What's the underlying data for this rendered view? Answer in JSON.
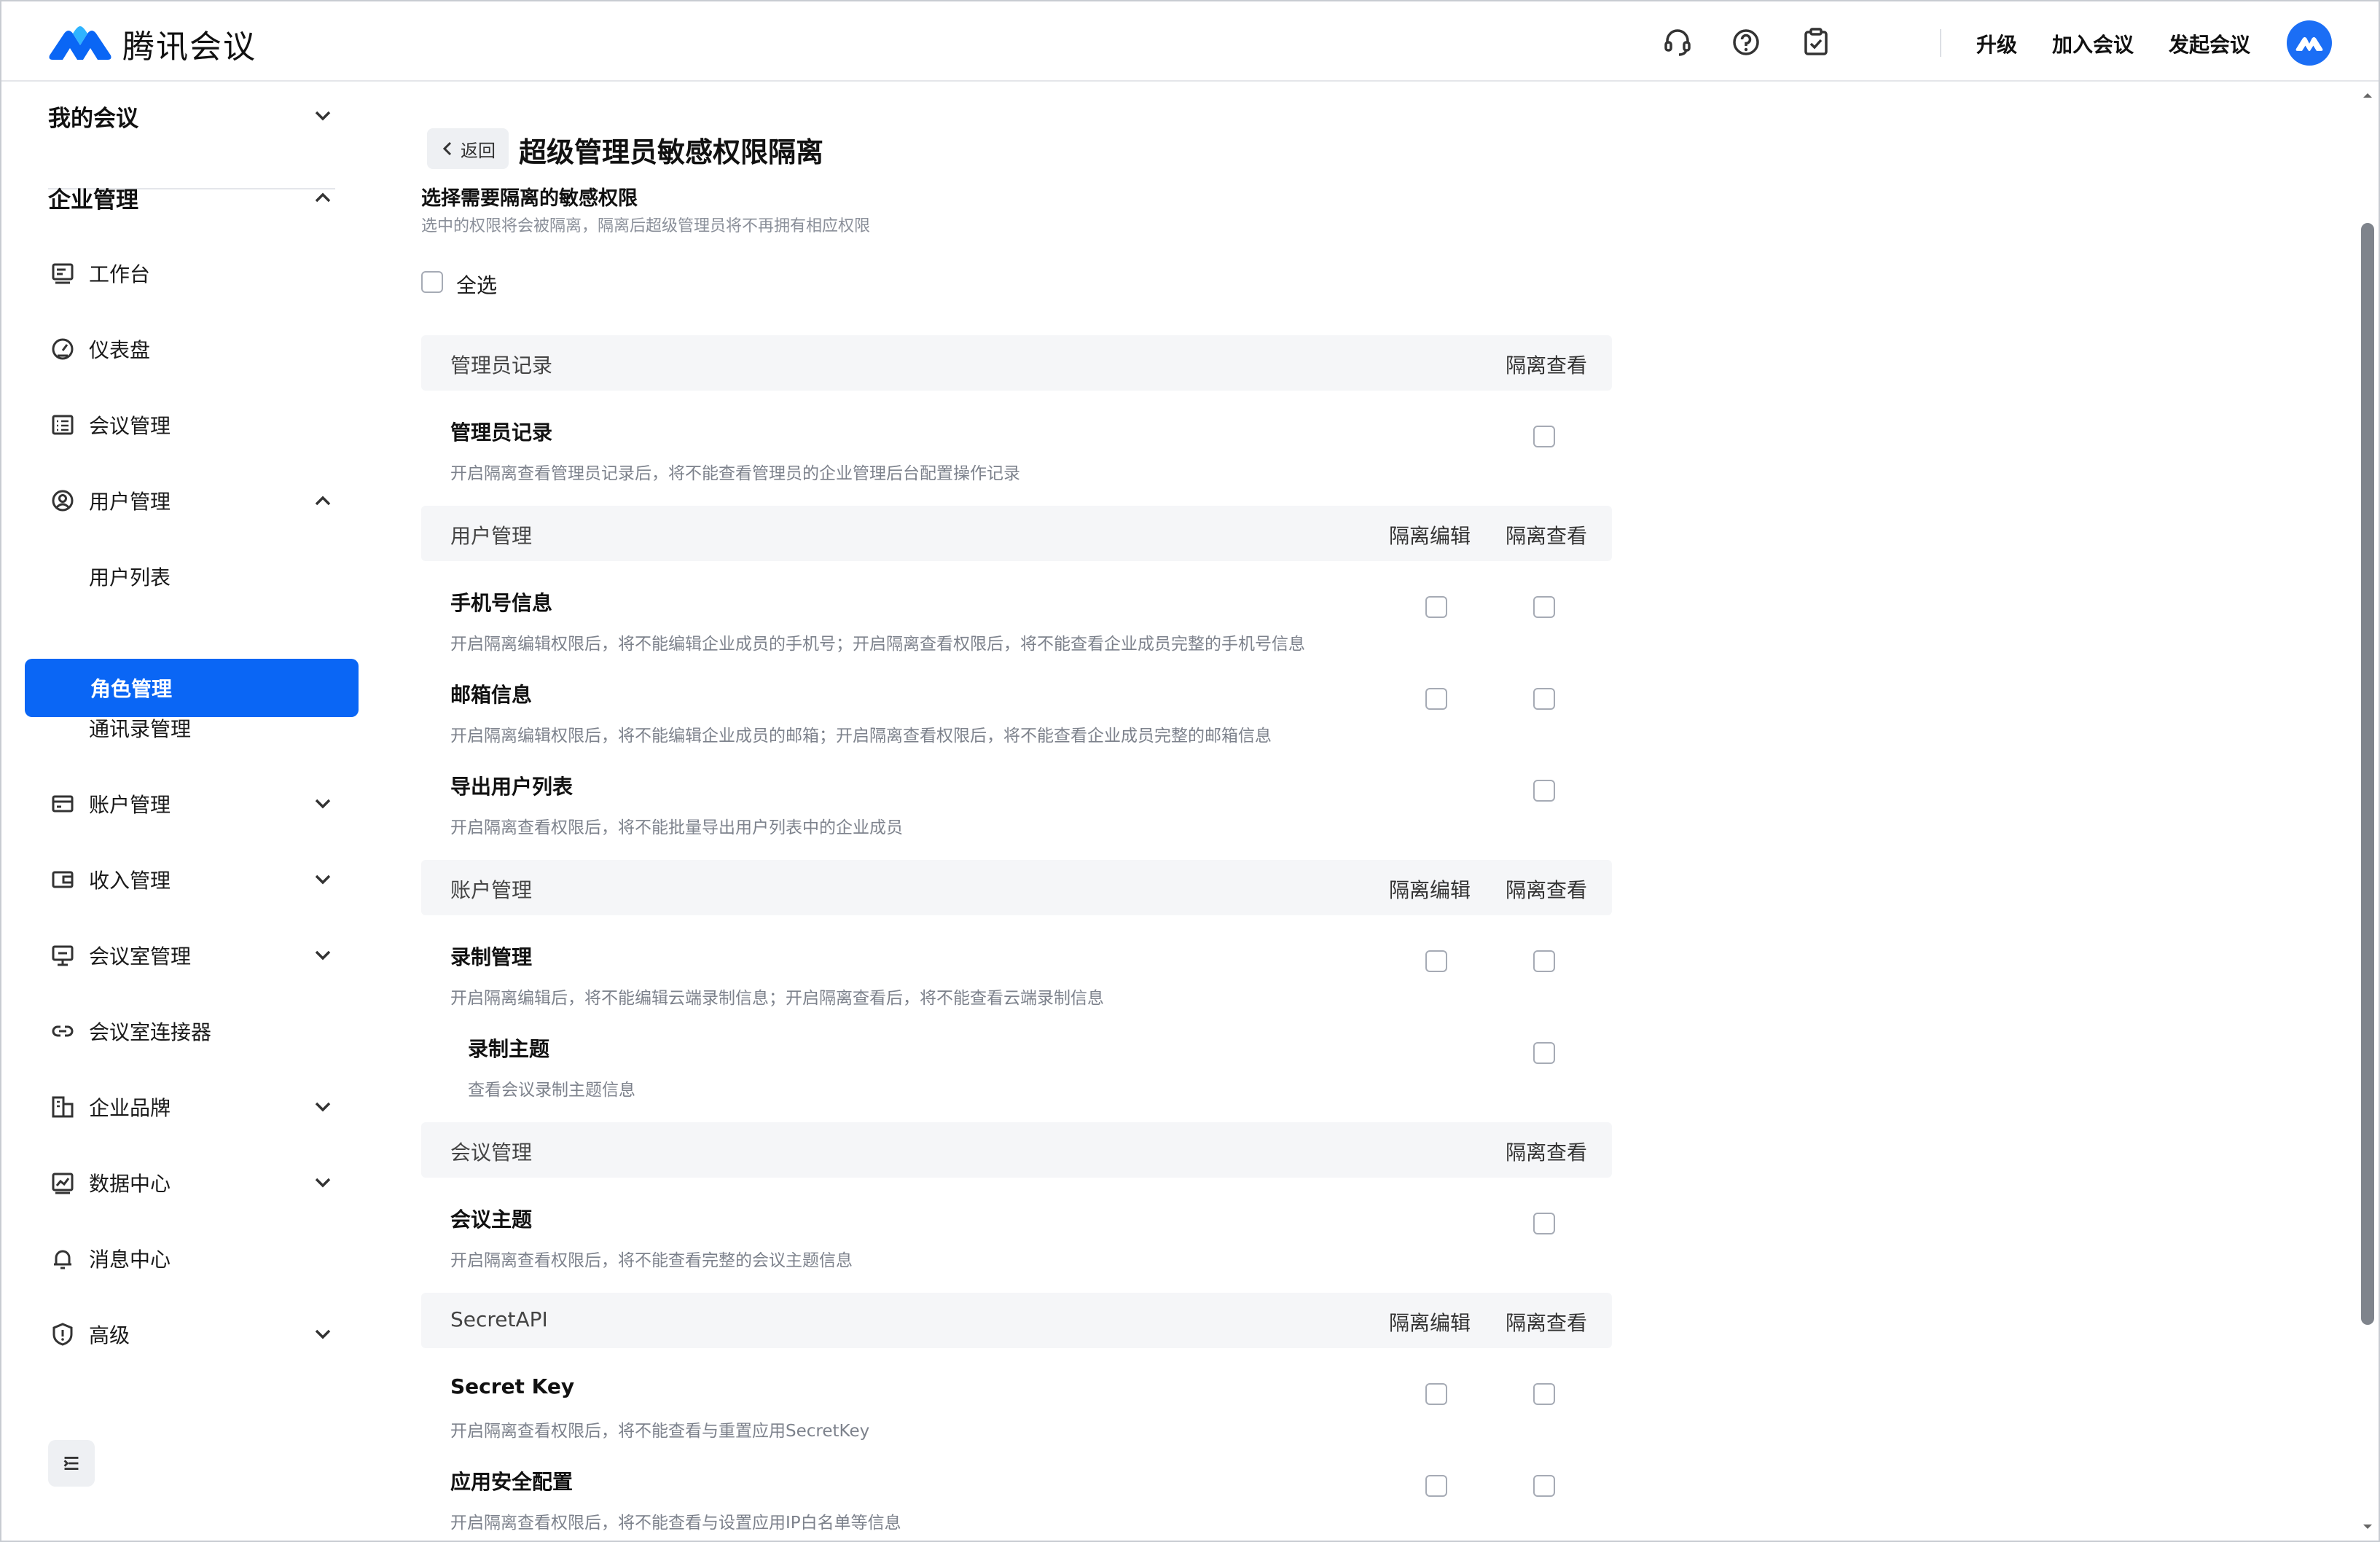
{
  "app": {
    "name": "腾讯会议",
    "brand_color": "#0a66f5"
  },
  "topbar": {
    "icons": [
      "headset-icon",
      "help-icon",
      "clipboard-check-icon"
    ],
    "upgrade": "升级",
    "join": "加入会议",
    "start": "发起会议"
  },
  "sidebar": {
    "my_meetings": "我的会议",
    "enterprise": "企业管理",
    "items": [
      {
        "label": "工作台",
        "icon": "workbench-icon"
      },
      {
        "label": "仪表盘",
        "icon": "dashboard-icon"
      },
      {
        "label": "会议管理",
        "icon": "meeting-list-icon"
      },
      {
        "label": "用户管理",
        "icon": "user-circle-icon"
      },
      {
        "label": "账户管理",
        "icon": "account-card-icon"
      },
      {
        "label": "收入管理",
        "icon": "wallet-icon"
      },
      {
        "label": "会议室管理",
        "icon": "room-icon"
      },
      {
        "label": "会议室连接器",
        "icon": "link-icon"
      },
      {
        "label": "企业品牌",
        "icon": "brand-icon"
      },
      {
        "label": "数据中心",
        "icon": "chart-icon"
      },
      {
        "label": "消息中心",
        "icon": "bell-icon"
      },
      {
        "label": "高级",
        "icon": "advanced-icon"
      }
    ],
    "sub_items": [
      "用户列表",
      "角色管理",
      "通讯录管理"
    ]
  },
  "page": {
    "back": "返回",
    "title": "超级管理员敏感权限隔离",
    "section_title": "选择需要隔离的敏感权限",
    "section_sub": "选中的权限将会被隔离，隔离后超级管理员将不再拥有相应权限",
    "select_all": "全选",
    "col_edit": "隔离编辑",
    "col_view": "隔离查看"
  },
  "groups": [
    {
      "name": "管理员记录",
      "perms": [
        {
          "name": "管理员记录",
          "desc": "开启隔离查看管理员记录后，将不能查看管理员的企业管理后台配置操作记录"
        }
      ]
    },
    {
      "name": "用户管理",
      "perms": [
        {
          "name": "手机号信息",
          "desc": "开启隔离编辑权限后，将不能编辑企业成员的手机号；开启隔离查看权限后，将不能查看企业成员完整的手机号信息"
        },
        {
          "name": "邮箱信息",
          "desc": "开启隔离编辑权限后，将不能编辑企业成员的邮箱；开启隔离查看权限后，将不能查看企业成员完整的邮箱信息"
        },
        {
          "name": "导出用户列表",
          "desc": "开启隔离查看权限后，将不能批量导出用户列表中的企业成员"
        }
      ]
    },
    {
      "name": "账户管理",
      "perms": [
        {
          "name": "录制管理",
          "desc": "开启隔离编辑后，将不能编辑云端录制信息；开启隔离查看后，将不能查看云端录制信息"
        },
        {
          "name": "录制主题",
          "desc": "查看会议录制主题信息"
        }
      ]
    },
    {
      "name": "会议管理",
      "perms": [
        {
          "name": "会议主题",
          "desc": "开启隔离查看权限后，将不能查看完整的会议主题信息"
        }
      ]
    },
    {
      "name": "SecretAPI",
      "perms": [
        {
          "name": "Secret Key",
          "desc": "开启隔离查看权限后，将不能查看与重置应用SecretKey"
        },
        {
          "name": "应用安全配置",
          "desc": "开启隔离查看权限后，将不能查看与设置应用IP白名单等信息"
        }
      ]
    }
  ]
}
